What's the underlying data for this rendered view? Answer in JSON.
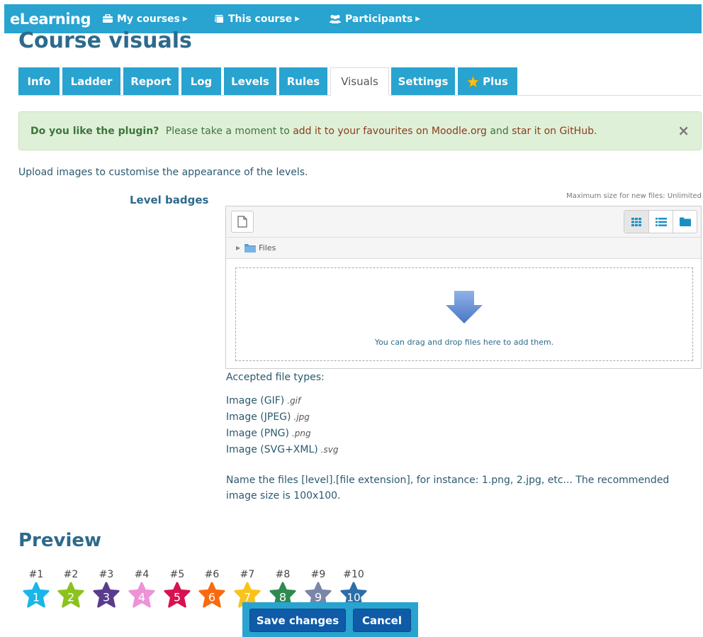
{
  "navbar": {
    "brand": "eLearning",
    "items": [
      {
        "label": "My courses",
        "icon": "briefcase-icon"
      },
      {
        "label": "This course",
        "icon": "book-icon"
      },
      {
        "label": "Participants",
        "icon": "users-icon"
      }
    ]
  },
  "page_title": "Course visuals",
  "tabs": [
    {
      "label": "Info"
    },
    {
      "label": "Ladder"
    },
    {
      "label": "Report"
    },
    {
      "label": "Log"
    },
    {
      "label": "Levels"
    },
    {
      "label": "Rules"
    },
    {
      "label": "Visuals",
      "active": true
    },
    {
      "label": "Settings"
    },
    {
      "label": "Plus",
      "icon": "star-icon"
    }
  ],
  "alert": {
    "bold": "Do you like the plugin?",
    "text1": "Please take a moment to",
    "link1": "add it to your favourites on Moodle.org",
    "text2": "and",
    "link2": "star it on GitHub",
    "text3": ".",
    "close": "×"
  },
  "intro": "Upload images to customise the appearance of the levels.",
  "level_badges": {
    "label": "Level badges",
    "max_size": "Maximum size for new files: Unlimited",
    "path_folder": "Files",
    "drop_text": "You can drag and drop files here to add them."
  },
  "accepted": {
    "title": "Accepted file types:",
    "types": [
      {
        "name": "Image (GIF)",
        "ext": ".gif"
      },
      {
        "name": "Image (JPEG)",
        "ext": ".jpg"
      },
      {
        "name": "Image (PNG)",
        "ext": ".png"
      },
      {
        "name": "Image (SVG+XML)",
        "ext": ".svg"
      }
    ]
  },
  "note": "Name the files [level].[file extension], for instance: 1.png, 2.jpg, etc... The recommended image size is 100x100.",
  "preview": {
    "title": "Preview",
    "badges": [
      {
        "label": "#1",
        "num": "1",
        "color": "#1ab6e8"
      },
      {
        "label": "#2",
        "num": "2",
        "color": "#8cc21d"
      },
      {
        "label": "#3",
        "num": "3",
        "color": "#5b3b8c"
      },
      {
        "label": "#4",
        "num": "4",
        "color": "#ee92d8"
      },
      {
        "label": "#5",
        "num": "5",
        "color": "#d8114f"
      },
      {
        "label": "#6",
        "num": "6",
        "color": "#f76b0f"
      },
      {
        "label": "#7",
        "num": "7",
        "color": "#f9c21c"
      },
      {
        "label": "#8",
        "num": "8",
        "color": "#2e8a4f"
      },
      {
        "label": "#9",
        "num": "9",
        "color": "#7b85a8"
      },
      {
        "label": "#10",
        "num": "10",
        "color": "#2b6ea8"
      }
    ]
  },
  "actions": {
    "save": "Save changes",
    "cancel": "Cancel"
  },
  "colors": {
    "brand": "#29a3d0",
    "primary_button": "#0f5ba8",
    "heading": "#2d6a8c",
    "alert_bg": "#dff0d8"
  }
}
